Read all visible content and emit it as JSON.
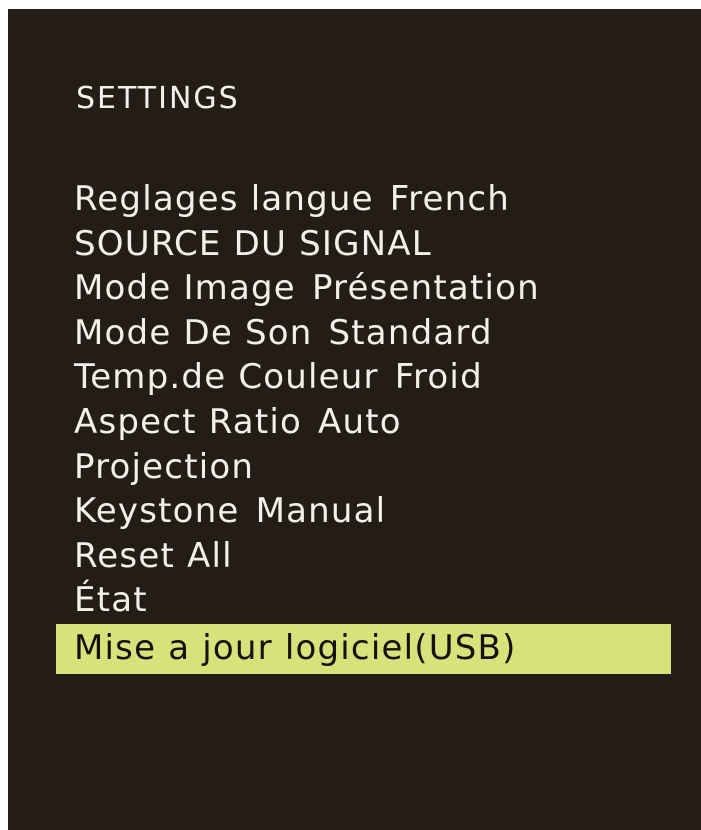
{
  "menu": {
    "title": "SETTINGS",
    "items": [
      {
        "label": "Reglages langue",
        "value": "French"
      },
      {
        "label": "SOURCE DU SIGNAL",
        "value": ""
      },
      {
        "label": "Mode Image",
        "value": "Présentation"
      },
      {
        "label": "Mode De Son",
        "value": "Standard"
      },
      {
        "label": "Temp.de Couleur",
        "value": "Froid"
      },
      {
        "label": "Aspect Ratio",
        "value": "Auto"
      },
      {
        "label": "Projection",
        "value": ""
      },
      {
        "label": "Keystone",
        "value": "Manual"
      },
      {
        "label": "Reset All",
        "value": ""
      },
      {
        "label": "État",
        "value": ""
      },
      {
        "label": "Mise a jour logiciel(USB)",
        "value": ""
      }
    ],
    "selected_index": 10
  },
  "colors": {
    "background": "#231c17",
    "text": "#f3efe9",
    "highlight": "#d8e27a",
    "highlight_text": "#15110d"
  }
}
